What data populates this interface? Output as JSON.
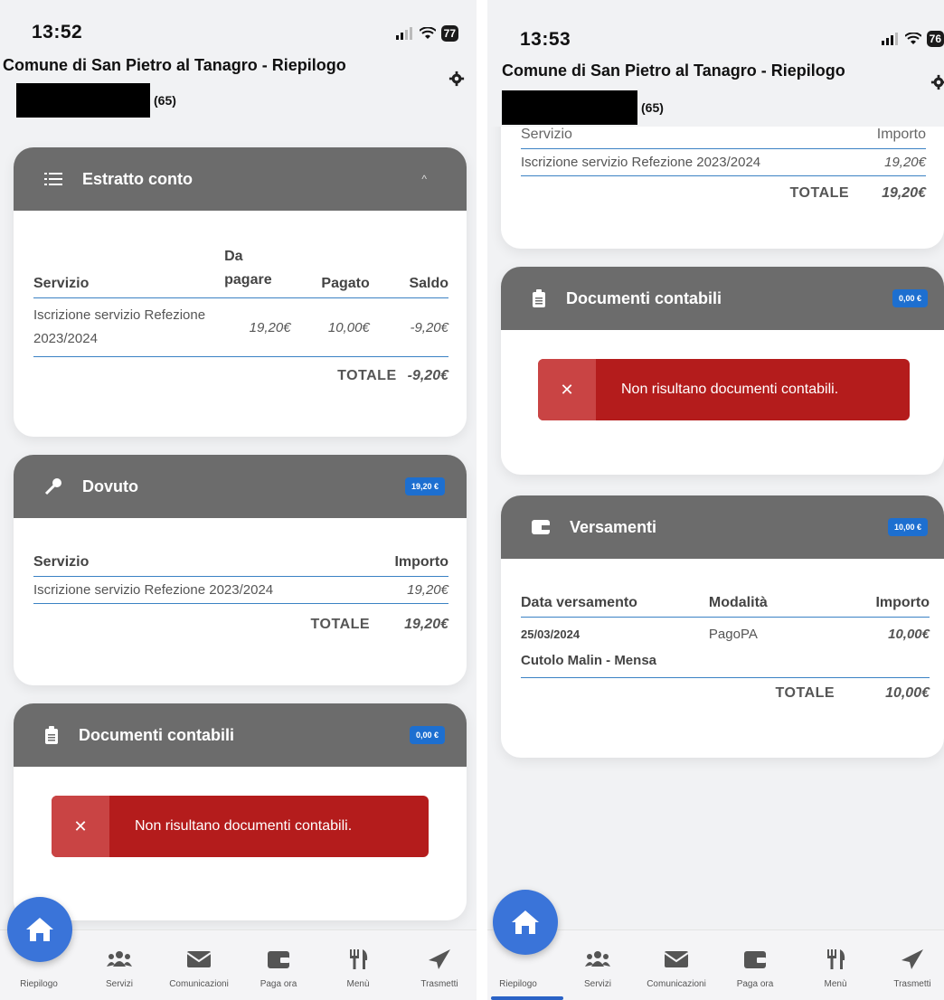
{
  "left": {
    "time": "13:52",
    "battery": "77",
    "app_title": "Comune di San Pietro al Tanagro - Riepilogo",
    "user_suffix": "(65)",
    "estratto": {
      "title": "Estratto conto",
      "headers": [
        "Servizio",
        "Da pagare",
        "Pagato",
        "Saldo"
      ],
      "row": {
        "servizio": "Iscrizione servizio Refezione 2023/2024",
        "da_pagare": "19,20€",
        "pagato": "10,00€",
        "saldo": "-9,20€"
      },
      "total_label": "TOTALE",
      "total_value": "-9,20€"
    },
    "dovuto": {
      "title": "Dovuto",
      "badge": "19,20 €",
      "headers": [
        "Servizio",
        "Importo"
      ],
      "row": {
        "servizio": "Iscrizione servizio Refezione 2023/2024",
        "importo": "19,20€"
      },
      "total_label": "TOTALE",
      "total_value": "19,20€"
    },
    "documenti": {
      "title": "Documenti contabili",
      "badge": "0,00 €",
      "alert": "Non risultano documenti contabili."
    }
  },
  "right": {
    "time": "13:53",
    "battery": "76",
    "app_title": "Comune di San Pietro al Tanagro - Riepilogo",
    "user_suffix": "(65)",
    "dovuto_partial": {
      "headers": [
        "Servizio",
        "Importo"
      ],
      "row": {
        "servizio": "Iscrizione servizio Refezione 2023/2024",
        "importo": "19,20€"
      },
      "total_label": "TOTALE",
      "total_value": "19,20€"
    },
    "documenti": {
      "title": "Documenti contabili",
      "badge": "0,00 €",
      "alert": "Non risultano documenti contabili."
    },
    "versamenti": {
      "title": "Versamenti",
      "badge": "10,00 €",
      "headers": [
        "Data versamento",
        "Modalità",
        "Importo"
      ],
      "row": {
        "data": "25/03/2024",
        "modalita": "PagoPA",
        "importo": "10,00€",
        "descrizione": "Cutolo Malin - Mensa"
      },
      "total_label": "TOTALE",
      "total_value": "10,00€"
    }
  },
  "tabs": [
    "Riepilogo",
    "Servizi",
    "Comunicazioni",
    "Paga ora",
    "Menù",
    "Trasmetti"
  ],
  "icons": {
    "list": "list-icon",
    "key": "key-icon",
    "clipboard": "clipboard-icon",
    "wallet": "wallet-icon",
    "home": "home-icon",
    "users": "users-icon",
    "envelope": "envelope-icon",
    "utensils": "utensils-icon",
    "send": "paper-plane-icon",
    "gear": "gear-icon",
    "close": "close-icon"
  },
  "colors": {
    "header": "#6c6c6c",
    "badge": "#1d6fd0",
    "alert": "#b41c1c",
    "fab": "#3a74d9",
    "divider": "#3b82c4"
  }
}
